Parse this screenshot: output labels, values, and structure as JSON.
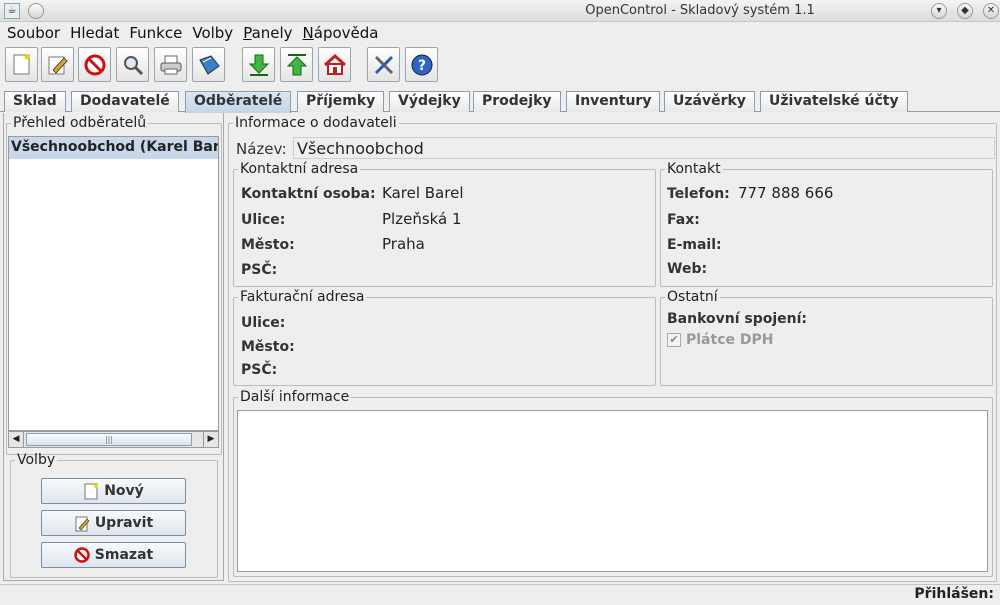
{
  "window": {
    "title": "OpenControl - Skladový systém 1.1"
  },
  "menu": [
    "Soubor",
    "Hledat",
    "Funkce",
    "Volby",
    "Panely",
    "Nápověda"
  ],
  "tabs": [
    "Sklad",
    "Dodavatelé",
    "Odběratelé",
    "Příjemky",
    "Výdejky",
    "Prodejky",
    "Inventury",
    "Uzávěrky",
    "Uživatelské účty"
  ],
  "left": {
    "overview_title": "Přehled odběratelů",
    "list_items": [
      "Všechnoobchod (Karel Barel)"
    ],
    "scroll_grip": "|||",
    "options_title": "Volby",
    "btn_new": "Nový",
    "btn_edit": "Upravit",
    "btn_delete": "Smazat"
  },
  "info": {
    "title": "Informace o dodavateli",
    "name_label": "Název:",
    "name_value": "Všechnoobchod",
    "contact_address": {
      "title": "Kontaktní adresa",
      "person_label": "Kontaktní osoba:",
      "person_value": "Karel Barel",
      "street_label": "Ulice:",
      "street_value": "Plzeňská 1",
      "city_label": "Město:",
      "city_value": "Praha",
      "zip_label": "PSČ:"
    },
    "contact": {
      "title": "Kontakt",
      "phone_label": "Telefon:",
      "phone_value": "777 888 666",
      "fax_label": "Fax:",
      "email_label": "E-mail:",
      "web_label": "Web:"
    },
    "billing": {
      "title": "Fakturační adresa",
      "street_label": "Ulice:",
      "city_label": "Město:",
      "zip_label": "PSČ:"
    },
    "other": {
      "title": "Ostatní",
      "bank_label": "Bankovní spojení:",
      "vat_label": "Plátce DPH",
      "vat_checked": true
    },
    "more_title": "Další informace"
  },
  "status": {
    "logged_in_label": "Přihlášen:"
  },
  "colors": {
    "accent": "#c4d5e8",
    "selection": "#c8d8ea"
  }
}
